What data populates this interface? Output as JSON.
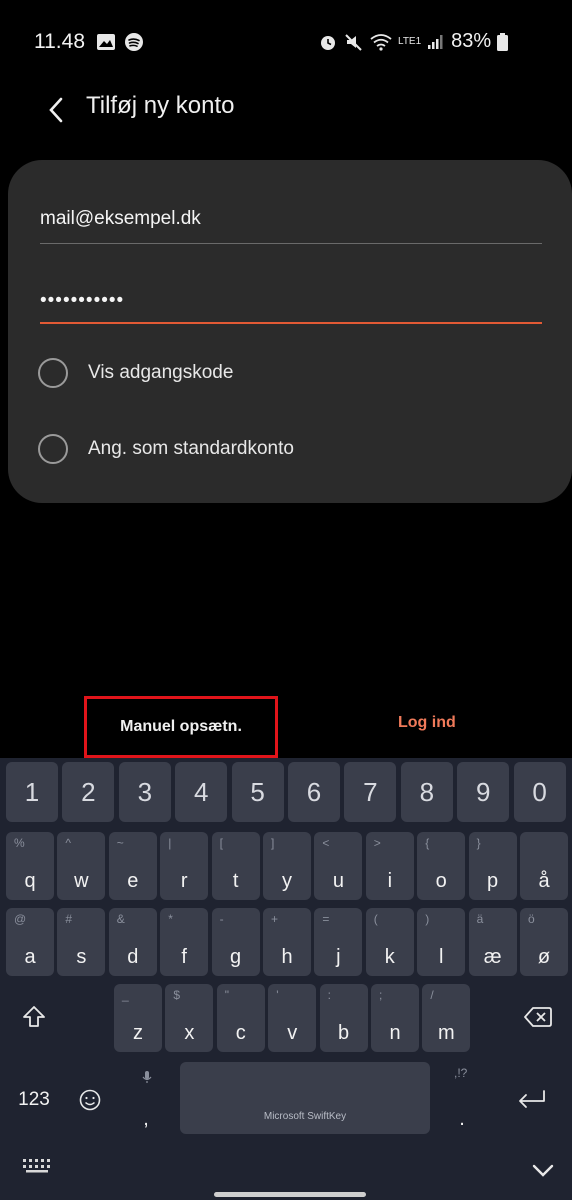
{
  "status_bar": {
    "time": "11.48",
    "battery": "83%",
    "network": "LTE1"
  },
  "header": {
    "title": "Tilføj ny konto"
  },
  "form": {
    "email_value": "mail@eksempel.dk",
    "password_value": "•••••••••••",
    "show_password_label": "Vis adgangskode",
    "default_account_label": "Ang. som standardkonto"
  },
  "actions": {
    "manual_setup_label": "Manuel opsætn.",
    "login_label": "Log ind"
  },
  "keyboard": {
    "brand": "Microsoft SwiftKey",
    "numbers": [
      "1",
      "2",
      "3",
      "4",
      "5",
      "6",
      "7",
      "8",
      "9",
      "0"
    ],
    "row1": [
      {
        "key": "q",
        "sub": "%"
      },
      {
        "key": "w",
        "sub": "^"
      },
      {
        "key": "e",
        "sub": "~"
      },
      {
        "key": "r",
        "sub": "|"
      },
      {
        "key": "t",
        "sub": "["
      },
      {
        "key": "y",
        "sub": "]"
      },
      {
        "key": "u",
        "sub": "<"
      },
      {
        "key": "i",
        "sub": ">"
      },
      {
        "key": "o",
        "sub": "{"
      },
      {
        "key": "p",
        "sub": "}"
      },
      {
        "key": "å",
        "sub": ""
      }
    ],
    "row2": [
      {
        "key": "a",
        "sub": "@"
      },
      {
        "key": "s",
        "sub": "#"
      },
      {
        "key": "d",
        "sub": "&"
      },
      {
        "key": "f",
        "sub": "*"
      },
      {
        "key": "g",
        "sub": "-"
      },
      {
        "key": "h",
        "sub": "+"
      },
      {
        "key": "j",
        "sub": "="
      },
      {
        "key": "k",
        "sub": "("
      },
      {
        "key": "l",
        "sub": ")"
      },
      {
        "key": "æ",
        "sub": "ä"
      },
      {
        "key": "ø",
        "sub": "ö"
      }
    ],
    "row3": [
      {
        "key": "z",
        "sub": "_"
      },
      {
        "key": "x",
        "sub": "$"
      },
      {
        "key": "c",
        "sub": "\""
      },
      {
        "key": "v",
        "sub": "'"
      },
      {
        "key": "b",
        "sub": ":"
      },
      {
        "key": "n",
        "sub": ";"
      },
      {
        "key": "m",
        "sub": "/"
      }
    ],
    "num_switch_label": "123",
    "comma_label": ",",
    "period_label": ".",
    "period_sub": ",!?"
  }
}
